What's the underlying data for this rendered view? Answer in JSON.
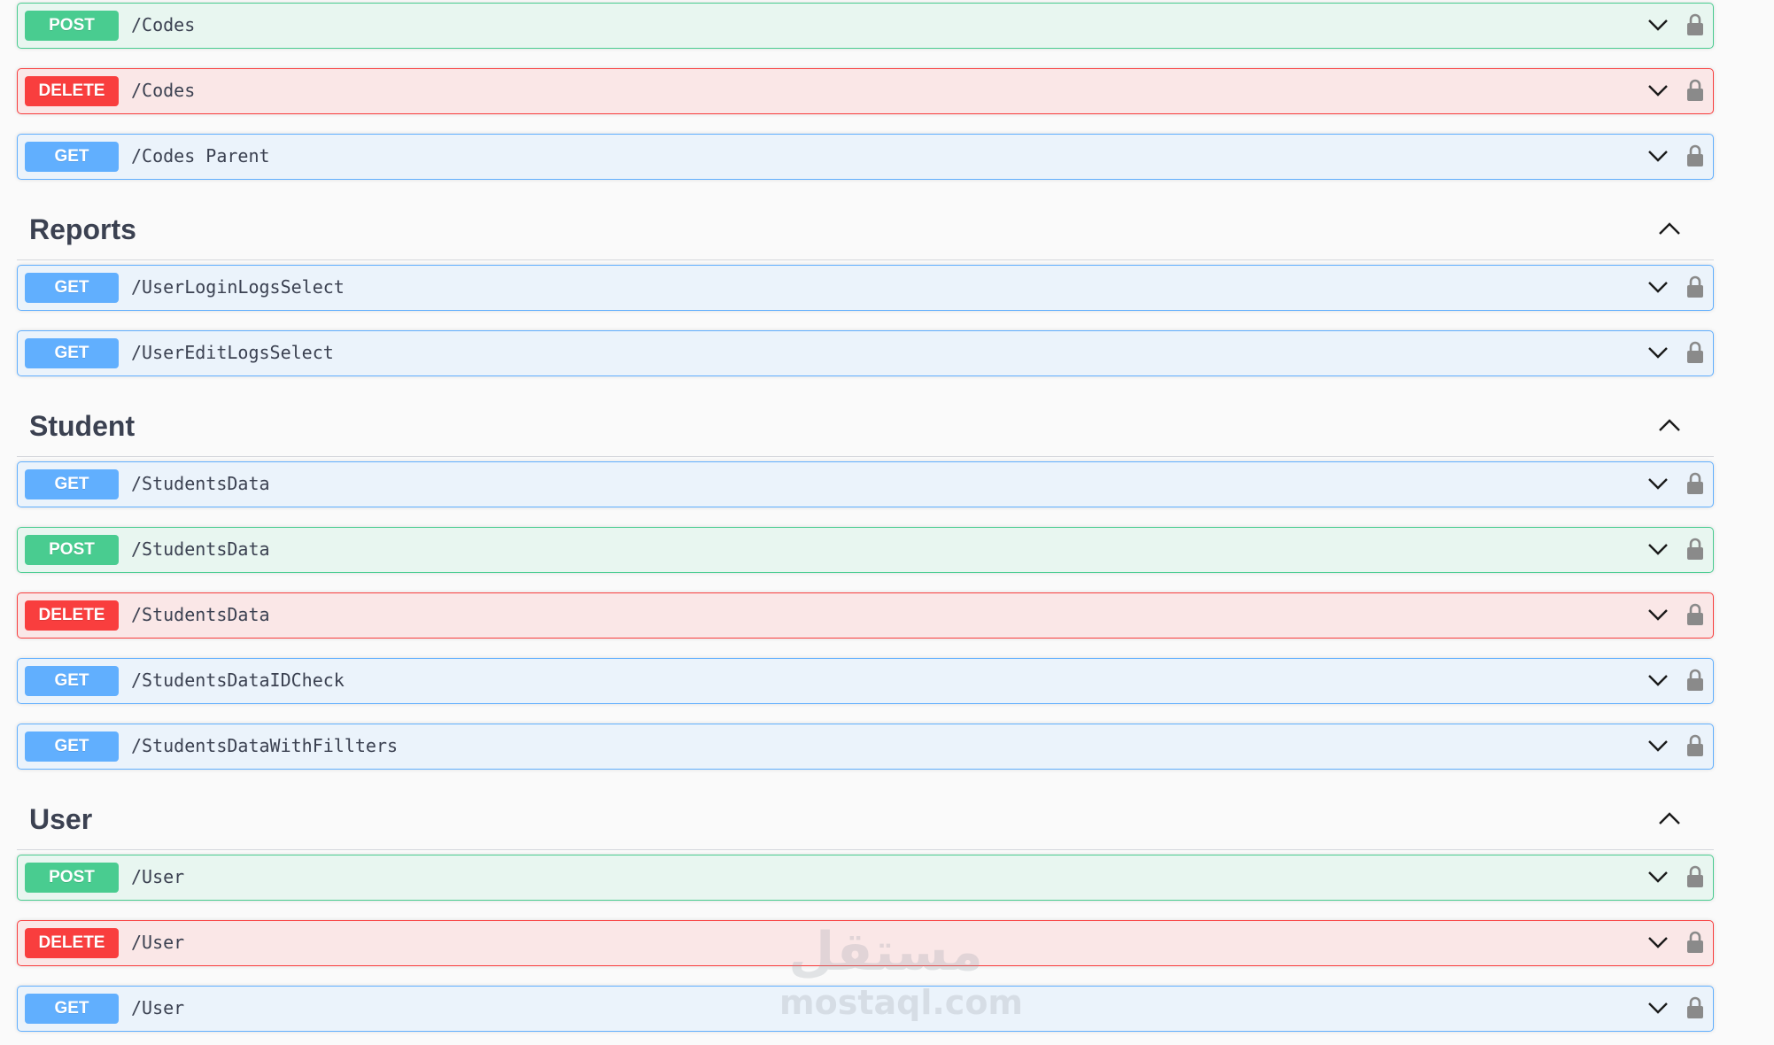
{
  "colors": {
    "get": "#61affe",
    "post": "#49cc90",
    "delete": "#f93e3e",
    "text": "#3b4151"
  },
  "operations_top": [
    {
      "method": "POST",
      "path": "/Codes"
    },
    {
      "method": "DELETE",
      "path": "/Codes"
    },
    {
      "method": "GET",
      "path": "/Codes Parent"
    }
  ],
  "sections": [
    {
      "title": "Reports",
      "operations": [
        {
          "method": "GET",
          "path": "/UserLoginLogsSelect"
        },
        {
          "method": "GET",
          "path": "/UserEditLogsSelect"
        }
      ]
    },
    {
      "title": "Student",
      "operations": [
        {
          "method": "GET",
          "path": "/StudentsData"
        },
        {
          "method": "POST",
          "path": "/StudentsData"
        },
        {
          "method": "DELETE",
          "path": "/StudentsData"
        },
        {
          "method": "GET",
          "path": "/StudentsDataIDCheck"
        },
        {
          "method": "GET",
          "path": "/StudentsDataWithFillters"
        }
      ]
    },
    {
      "title": "User",
      "operations": [
        {
          "method": "POST",
          "path": "/User"
        },
        {
          "method": "DELETE",
          "path": "/User"
        },
        {
          "method": "GET",
          "path": "/User"
        }
      ]
    }
  ],
  "icons": {
    "expand": "chevron-down-icon",
    "collapse": "chevron-up-icon",
    "auth": "lock-icon"
  },
  "watermark": {
    "logo": "مستقل",
    "text": "mostaql.com"
  }
}
